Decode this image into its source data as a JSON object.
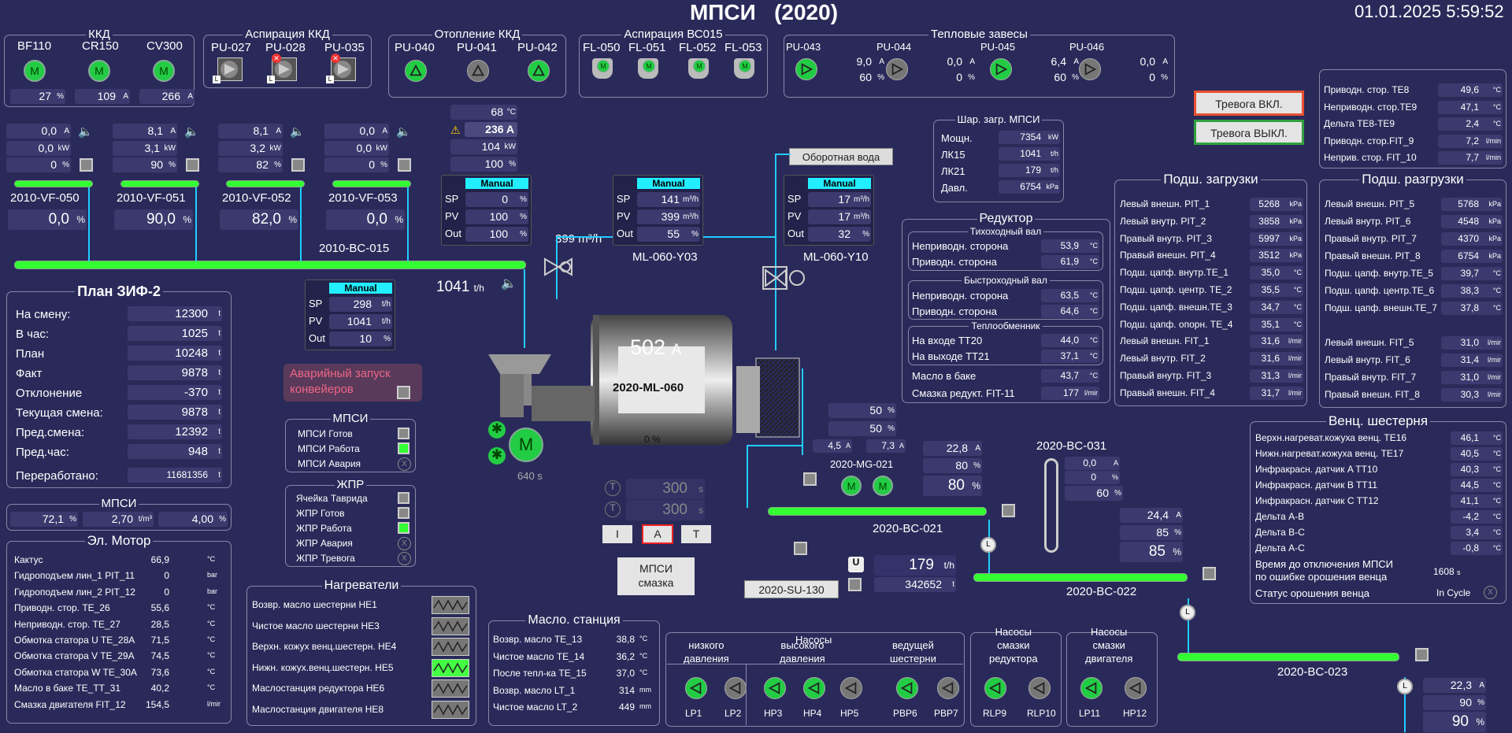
{
  "title": "МПСИ   (2020)",
  "datetime": "01.01.2025 5:59:52",
  "kkd": {
    "title": "ККД",
    "units": [
      {
        "name": "BF110",
        "val": "27",
        "u": "%"
      },
      {
        "name": "CR150",
        "val": "109",
        "u": "A"
      },
      {
        "name": "CV300",
        "val": "266",
        "u": "A"
      }
    ]
  },
  "asp_kkd": {
    "title": "Аспирация ККД",
    "units": [
      "PU-027",
      "PU-028",
      "PU-035"
    ]
  },
  "heat_kkd": {
    "title": "Отопление ККД",
    "units": [
      "PU-040",
      "PU-041",
      "PU-042"
    ]
  },
  "asp_bc": {
    "title": "Аспирация ВС015",
    "units": [
      "FL-050",
      "FL-051",
      "FL-052",
      "FL-053"
    ]
  },
  "curtains": {
    "title": "Тепловые завесы",
    "units": [
      {
        "name": "PU-043",
        "a": "9,0",
        "p": "60"
      },
      {
        "name": "PU-044",
        "a": "0,0",
        "p": "0"
      },
      {
        "name": "PU-045",
        "a": "6,4",
        "p": "60"
      },
      {
        "name": "PU-046",
        "a": "0,0",
        "p": "0"
      }
    ]
  },
  "feeders": [
    {
      "name": "2010-VF-050",
      "a": "0,0",
      "kw": "0,0",
      "p": "0",
      "sp": "0,0"
    },
    {
      "name": "2010-VF-051",
      "a": "8,1",
      "kw": "3,1",
      "p": "90",
      "sp": "90,0"
    },
    {
      "name": "2010-VF-052",
      "a": "8,1",
      "kw": "3,2",
      "p": "82",
      "sp": "82,0"
    },
    {
      "name": "2010-VF-053",
      "a": "0,0",
      "kw": "0,0",
      "p": "0",
      "sp": "0,0"
    }
  ],
  "bc015": "2010-BC-015",
  "mill_top": {
    "temp": "68",
    "amps": "236 A",
    "kw": "104",
    "pct": "100"
  },
  "manual1": {
    "mode": "Manual",
    "sp": "298",
    "spu": "t/h",
    "pv": "1041",
    "pvu": "t/h",
    "out": "10",
    "outu": "%"
  },
  "manual2": {
    "mode": "Manual",
    "sp": "0",
    "spu": "%",
    "pv": "100",
    "pvu": "%",
    "out": "100",
    "outu": "%"
  },
  "manual3": {
    "mode": "Manual",
    "sp": "141",
    "spu": "m³/h",
    "pv": "399",
    "pvu": "m³/h",
    "out": "55",
    "outu": "%"
  },
  "manual4": {
    "mode": "Manual",
    "sp": "17",
    "spu": "m³/h",
    "pv": "17",
    "pvu": "m³/h",
    "out": "32",
    "outu": "%"
  },
  "water_flow": "399 m³/h",
  "ml_y03": "ML-060-Y03",
  "ml_y10": "ML-060-Y10",
  "recycle_water": "Оборотная вода",
  "belt_rate": "1041",
  "belt_rate_u": "t/h",
  "mill": {
    "name": "2020-ML-060",
    "amps": "502",
    "ampsu": "A",
    "speed": "0 %",
    "time": "640 s"
  },
  "timer1": "300",
  "timer2": "300",
  "timer_u": "s",
  "mode_buttons": [
    "I",
    "A",
    "T"
  ],
  "lube_button": "МПСИ\nсмазка",
  "su130": "2020-SU-130",
  "su_rate": "179",
  "su_rate_u": "t/h",
  "su_total": "342652",
  "su_total_u": "t",
  "mg021": {
    "name": "2020-MG-021",
    "a1": "4,5",
    "a2": "7,3",
    "p1": "50",
    "p2": "50"
  },
  "bc021": {
    "name": "2020-BC-021",
    "a": "22,8",
    "p": "80",
    "sp": "80"
  },
  "bc031": {
    "name": "2020-BC-031",
    "a": "0,0",
    "p": "0",
    "sp": "60"
  },
  "bc022": {
    "name": "2020-BC-022",
    "a": "24,4",
    "p": "85",
    "sp": "85"
  },
  "bc023": {
    "name": "2020-BC-023",
    "a": "22,3",
    "p": "90",
    "sp": "90"
  },
  "plan": {
    "title": "План ЗИФ-2",
    "rows": [
      {
        "l": "На смену:",
        "v": "12300",
        "u": "t"
      },
      {
        "l": "В час:",
        "v": "1025",
        "u": "t"
      },
      {
        "l": "План",
        "v": "10248",
        "u": "t"
      },
      {
        "l": "Факт",
        "v": "9878",
        "u": "t"
      },
      {
        "l": "Отклонение",
        "v": "-370",
        "u": "t"
      },
      {
        "l": "Текущая смена:",
        "v": "9878",
        "u": "t"
      },
      {
        "l": "Пред.смена:",
        "v": "12392",
        "u": "t"
      },
      {
        "l": "Пред.час:",
        "v": "948",
        "u": "t"
      },
      {
        "l": "Переработано:",
        "v": "11681356",
        "u": "t"
      }
    ]
  },
  "emergency": "Аварийный запуск\nконвейеров",
  "mpsi_status": {
    "title": "МПСИ",
    "items": [
      "МПСИ Готов",
      "МПСИ Работа",
      "МПСИ Авария"
    ]
  },
  "zhpr": {
    "title": "ЖПР",
    "items": [
      "Ячейка Таврида",
      "ЖПР Готов",
      "ЖПР Работа",
      "ЖПР Авария",
      "ЖПР Тревога"
    ]
  },
  "mpsi_small": {
    "title": "МПСИ",
    "v1": "72,1",
    "u1": "%",
    "v2": "2,70",
    "u2": "t/m³",
    "v3": "4,00",
    "u3": "%"
  },
  "motor": {
    "title": "Эл. Мотор",
    "rows": [
      {
        "l": "Кактус",
        "v": "66,9",
        "u": "°C"
      },
      {
        "l": "Гидроподъем лин_1 PIT_11",
        "v": "0",
        "u": "bar"
      },
      {
        "l": "Гидроподъем лин_2 PIT_12",
        "v": "0",
        "u": "bar"
      },
      {
        "l": "Приводн. стор. TE_26",
        "v": "55,6",
        "u": "°C"
      },
      {
        "l": "Неприводн. стор. TE_27",
        "v": "28,5",
        "u": "°C"
      },
      {
        "l": "Обмотка статора U TE_28A",
        "v": "71,5",
        "u": "°C"
      },
      {
        "l": "Обмотка статора V TE_29A",
        "v": "74,5",
        "u": "°C"
      },
      {
        "l": "Обмотка статора W TE_30A",
        "v": "73,6",
        "u": "°C"
      },
      {
        "l": "Масло в баке TE_TT_31",
        "v": "40,2",
        "u": "°C"
      },
      {
        "l": "Смазка двигателя FIT_12",
        "v": "154,5",
        "u": "l/mir"
      }
    ]
  },
  "heaters": {
    "title": "Нагреватели",
    "items": [
      {
        "l": "Возвр. масло шестерни HE1",
        "on": false
      },
      {
        "l": "Чистое масло шестерни HE3",
        "on": false
      },
      {
        "l": "Верхн. кожух венц.шестерн. HE4",
        "on": false
      },
      {
        "l": "Нижн. кожух.венц.шестерн. HE5",
        "on": true
      },
      {
        "l": "Маслостанция редуктора HE6",
        "on": false
      },
      {
        "l": "Маслостанция двигателя HE8",
        "on": false
      }
    ]
  },
  "oil": {
    "title": "Масло. станция",
    "rows": [
      {
        "l": "Возвр. масло TE_13",
        "v": "38,8",
        "u": "°C"
      },
      {
        "l": "Чистое масло TE_14",
        "v": "36,2",
        "u": "°C"
      },
      {
        "l": "После тепл-ка TE_15",
        "v": "37,0",
        "u": "°C"
      },
      {
        "l": "Возвр. масло LT_1",
        "v": "314",
        "u": "mm"
      },
      {
        "l": "Чистое масло LT_2",
        "v": "449",
        "u": "mm"
      }
    ]
  },
  "pumps": {
    "groups": [
      {
        "title": "низкого\nдавления",
        "pumps": [
          {
            "n": "LP1",
            "on": true
          },
          {
            "n": "LP2",
            "on": false
          }
        ]
      },
      {
        "title": "высокого\nдавления",
        "pumps": [
          {
            "n": "HP3",
            "on": true
          },
          {
            "n": "HP4",
            "on": true
          },
          {
            "n": "HP5",
            "on": false
          }
        ]
      },
      {
        "title": "ведущей\nшестерни",
        "pumps": [
          {
            "n": "PBP6",
            "on": true
          },
          {
            "n": "PBP7",
            "on": false
          }
        ]
      }
    ],
    "top": "Насосы"
  },
  "pumps_red": {
    "title": "Насосы\nсмазки\nредуктора",
    "pumps": [
      {
        "n": "RLP9",
        "on": true
      },
      {
        "n": "RLP10",
        "on": false
      }
    ]
  },
  "pumps_eng": {
    "title": "Насосы\nсмазки\nдвигателя",
    "pumps": [
      {
        "n": "LP11",
        "on": true
      },
      {
        "n": "HP12",
        "on": false
      }
    ]
  },
  "ball": {
    "title": "Шар. загр. МПСИ",
    "rows": [
      {
        "l": "Мощн.",
        "v": "7354",
        "u": "kW"
      },
      {
        "l": "ЛК15",
        "v": "1041",
        "u": "t/h"
      },
      {
        "l": "ЛК21",
        "v": "179",
        "u": "t/h"
      },
      {
        "l": "Давл.",
        "v": "6754",
        "u": "kPa"
      }
    ]
  },
  "reducer": {
    "title": "Редуктор",
    "slow": "Тихоходный вал",
    "fast": "Быстроходный вал",
    "hx": "Теплообменник",
    "rows": [
      {
        "l": "Неприводн. сторона",
        "v": "53,9",
        "u": "°C"
      },
      {
        "l": "Приводн. сторона",
        "v": "61,9",
        "u": "°C"
      },
      {
        "l": "Неприводн. сторона",
        "v": "63,5",
        "u": "°C"
      },
      {
        "l": "Приводн. сторона",
        "v": "64,6",
        "u": "°C"
      },
      {
        "l": "На входе TT20",
        "v": "44,0",
        "u": "°C"
      },
      {
        "l": "На выходе TT21",
        "v": "37,1",
        "u": "°C"
      },
      {
        "l": "Масло в баке",
        "v": "43,7",
        "u": "°C"
      },
      {
        "l": "Смазка редукт. FIT-11",
        "v": "177",
        "u": "l/mir"
      }
    ]
  },
  "load": {
    "title": "Подш. загрузки",
    "rows": [
      {
        "l": "Левый внешн. PIT_1",
        "v": "5268",
        "u": "kPa"
      },
      {
        "l": "Левый внутр. PIT_2",
        "v": "3858",
        "u": "kPa"
      },
      {
        "l": "Правый внутр. PIT_3",
        "v": "5997",
        "u": "kPa"
      },
      {
        "l": "Правый внешн. PIT_4",
        "v": "3512",
        "u": "kPa"
      },
      {
        "l": "Подш. цапф. внутр.TE_1",
        "v": "35,0",
        "u": "°C"
      },
      {
        "l": "Подш. цапф. центр. TE_2",
        "v": "35,5",
        "u": "°C"
      },
      {
        "l": "Подш. цапф. внешн.TE_3",
        "v": "34,7",
        "u": "°C"
      },
      {
        "l": "Подш. цапф. опорн. TE_4",
        "v": "35,1",
        "u": "°C"
      },
      {
        "l": "Левый внешн. FIT_1",
        "v": "31,6",
        "u": "l/mir"
      },
      {
        "l": "Левый внутр. FIT_2",
        "v": "31,6",
        "u": "l/mir"
      },
      {
        "l": "Правый внутр. FIT_3",
        "v": "31,3",
        "u": "l/mir"
      },
      {
        "l": "Правый внешн. FIT_4",
        "v": "31,7",
        "u": "l/mir"
      }
    ]
  },
  "alarm_on": "Тревога ВКЛ.",
  "alarm_off": "Тревога ВЫКЛ.",
  "te_box": {
    "rows": [
      {
        "l": "Приводн. стор. TE8",
        "v": "49,6",
        "u": "°C"
      },
      {
        "l": "Неприводн. стор.TE9",
        "v": "47,1",
        "u": "°C"
      },
      {
        "l": "Дельта TE8-TE9",
        "v": "2,4",
        "u": "°C"
      },
      {
        "l": "Приводн. стор.FIT_9",
        "v": "7,2",
        "u": "l/min"
      },
      {
        "l": "Неприв. стор. FIT_10",
        "v": "7,7",
        "u": "l/min"
      }
    ]
  },
  "unload": {
    "title": "Подш. разгрузки",
    "rows": [
      {
        "l": "Левый внешн. PIT_5",
        "v": "5768",
        "u": "kPa"
      },
      {
        "l": "Левый внутр. PIT_6",
        "v": "4548",
        "u": "kPa"
      },
      {
        "l": "Правый внутр. PIT_7",
        "v": "4370",
        "u": "kPa"
      },
      {
        "l": "Правый внешн. PIT_8",
        "v": "6754",
        "u": "kPa"
      },
      {
        "l": "Подш. цапф. внутр.TE_5",
        "v": "39,7",
        "u": "°C"
      },
      {
        "l": "Подш. цапф. центр.TE_6",
        "v": "38,3",
        "u": "°C"
      },
      {
        "l": "Подш. цапф. внешн.TE_7",
        "v": "37,8",
        "u": "°C"
      },
      {
        "l": "Левый внешн. FIT_5",
        "v": "31,0",
        "u": "l/mir"
      },
      {
        "l": "Левый внутр. FIT_6",
        "v": "31,4",
        "u": "l/mir"
      },
      {
        "l": "Правый внутр.  FIT_7",
        "v": "31,0",
        "u": "l/mir"
      },
      {
        "l": "Правый внешн. FIT_8",
        "v": "30,3",
        "u": "l/mir"
      }
    ]
  },
  "gear": {
    "title": "Венц. шестерня",
    "rows": [
      {
        "l": "Верхн.нагреват.кожуха венц. TE16",
        "v": "46,1",
        "u": "°C"
      },
      {
        "l": "Нижн.нагреват.кожуха венц. TE17",
        "v": "40,5",
        "u": "°C"
      },
      {
        "l": "Инфракрасн. датчик A TT10",
        "v": "40,3",
        "u": "°C"
      },
      {
        "l": "Инфракрасн. датчик B TT11",
        "v": "44,5",
        "u": "°C"
      },
      {
        "l": "Инфракрасн. датчик C TT12",
        "v": "41,1",
        "u": "°C"
      },
      {
        "l": "Дельта A-B",
        "v": "-4,2",
        "u": "°C"
      },
      {
        "l": "Дельта B-C",
        "v": "3,4",
        "u": "°C"
      },
      {
        "l": "Дельта A-C",
        "v": "-0,8",
        "u": "°C"
      }
    ],
    "spray_time_l": "Время до отключения МПСИ\nпо ошибке орошения венца",
    "spray_time_v": "1608",
    "spray_time_u": "s",
    "spray_status_l": "Статус орошения венца",
    "spray_status_v": "In Cycle"
  }
}
